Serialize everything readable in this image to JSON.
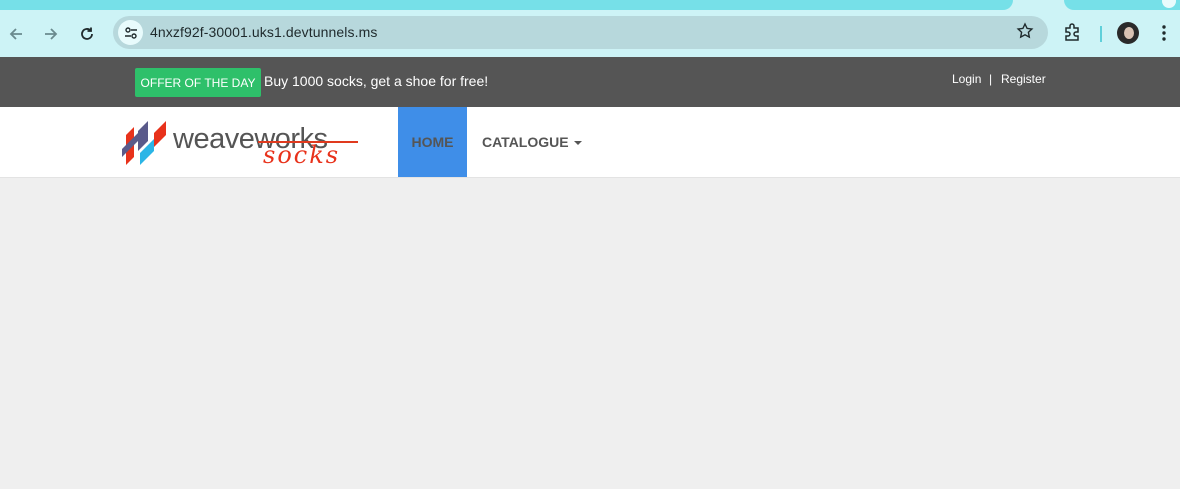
{
  "browser": {
    "url": "4nxzf92f-30001.uks1.devtunnels.ms",
    "icons": [
      "back-icon",
      "forward-icon",
      "reload-icon",
      "site-info-icon",
      "bookmark-star-icon",
      "extensions-icon",
      "profile-avatar",
      "more-menu-icon"
    ]
  },
  "topbar": {
    "offer_label": "OFFER OF THE DAY",
    "offer_text": "Buy 1000 socks, get a shoe for free!",
    "login": "Login",
    "separator": "|",
    "register": "Register"
  },
  "navbar": {
    "logo": {
      "word1": "weave",
      "word2": "works",
      "word3": "socks"
    },
    "home": "HOME",
    "catalogue": "CATALOGUE"
  },
  "colors": {
    "chrome": "#cdf3f6",
    "tab_accent": "#76e0e8",
    "topbar": "#555555",
    "offer": "#2ec06a",
    "home_active": "#3f8ee8",
    "page_bg": "#efefef"
  }
}
